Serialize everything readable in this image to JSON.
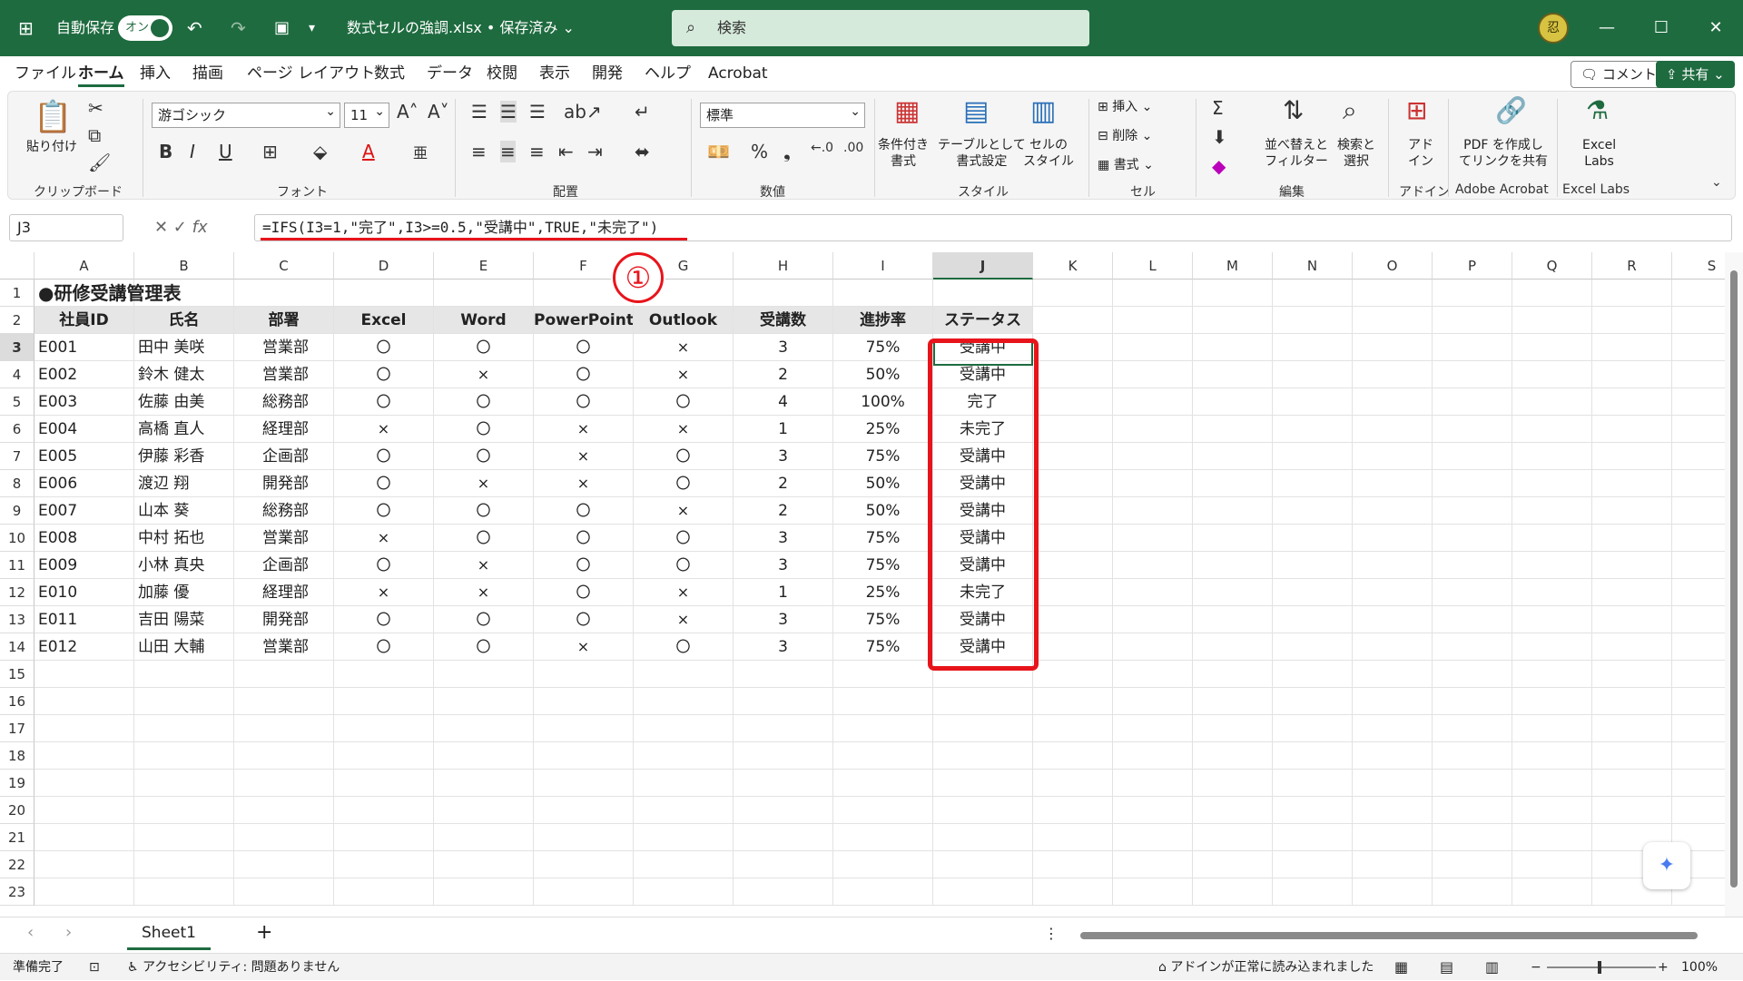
{
  "title_bar": {
    "autosave_label": "自動保存",
    "autosave_state": "オン",
    "filename": "数式セルの強調.xlsx • 保存済み ⌄",
    "search_placeholder": "検索",
    "avatar_text": "忍"
  },
  "menu": {
    "tabs": [
      "ファイル",
      "ホーム",
      "挿入",
      "描画",
      "ページ レイアウト",
      "数式",
      "データ",
      "校閲",
      "表示",
      "開発",
      "ヘルプ",
      "Acrobat"
    ],
    "active": "ホーム",
    "comment_button": "コメント",
    "share_button": "共有"
  },
  "ribbon": {
    "groups": [
      "クリップボード",
      "フォント",
      "配置",
      "数値",
      "スタイル",
      "セル",
      "編集",
      "アドイン",
      "Adobe Acrobat",
      "Excel Labs"
    ],
    "paste": "貼り付け",
    "font_name": "游ゴシック",
    "font_size": "11",
    "number_format": "標準",
    "conditional_format": "条件付き\n書式",
    "format_as_table": "テーブルとして\n書式設定",
    "cell_styles": "セルの\nスタイル",
    "insert": "挿入",
    "delete": "削除",
    "format": "書式",
    "sort_filter": "並べ替えと\nフィルター",
    "find_select": "検索と\n選択",
    "addin": "アド\nイン",
    "pdf_share": "PDF を作成し\nてリンクを共有",
    "excel_labs": "Excel\nLabs",
    "accent_color": "#1e6b3f"
  },
  "formula_bar": {
    "name_box": "J3",
    "formula": "=IFS(I3=1,\"完了\",I3>=0.5,\"受講中\",TRUE,\"未完了\")"
  },
  "annotation": {
    "number": "①",
    "highlight_color": "#e8141b"
  },
  "columns": [
    "A",
    "B",
    "C",
    "D",
    "E",
    "F",
    "G",
    "H",
    "I",
    "J",
    "K",
    "L",
    "M",
    "N",
    "O",
    "P",
    "Q",
    "R",
    "S"
  ],
  "rows": [
    "1",
    "2",
    "3",
    "4",
    "5",
    "6",
    "7",
    "8",
    "9",
    "10",
    "11",
    "12",
    "13",
    "14",
    "15",
    "16",
    "17",
    "18",
    "19",
    "20",
    "21",
    "22",
    "23"
  ],
  "sheet": {
    "title": "●研修受講管理表",
    "headers": [
      "社員ID",
      "氏名",
      "部署",
      "Excel",
      "Word",
      "PowerPoint",
      "Outlook",
      "受講数",
      "進捗率",
      "ステータス"
    ],
    "data": [
      [
        "E001",
        "田中 美咲",
        "営業部",
        "〇",
        "〇",
        "〇",
        "×",
        "3",
        "75%",
        "受講中"
      ],
      [
        "E002",
        "鈴木 健太",
        "営業部",
        "〇",
        "×",
        "〇",
        "×",
        "2",
        "50%",
        "受講中"
      ],
      [
        "E003",
        "佐藤 由美",
        "総務部",
        "〇",
        "〇",
        "〇",
        "〇",
        "4",
        "100%",
        "完了"
      ],
      [
        "E004",
        "高橋 直人",
        "経理部",
        "×",
        "〇",
        "×",
        "×",
        "1",
        "25%",
        "未完了"
      ],
      [
        "E005",
        "伊藤 彩香",
        "企画部",
        "〇",
        "〇",
        "×",
        "〇",
        "3",
        "75%",
        "受講中"
      ],
      [
        "E006",
        "渡辺 翔",
        "開発部",
        "〇",
        "×",
        "×",
        "〇",
        "2",
        "50%",
        "受講中"
      ],
      [
        "E007",
        "山本 葵",
        "総務部",
        "〇",
        "〇",
        "〇",
        "×",
        "2",
        "50%",
        "受講中"
      ],
      [
        "E008",
        "中村 拓也",
        "営業部",
        "×",
        "〇",
        "〇",
        "〇",
        "3",
        "75%",
        "受講中"
      ],
      [
        "E009",
        "小林 真央",
        "企画部",
        "〇",
        "×",
        "〇",
        "〇",
        "3",
        "75%",
        "受講中"
      ],
      [
        "E010",
        "加藤 優",
        "経理部",
        "×",
        "×",
        "〇",
        "×",
        "1",
        "25%",
        "未完了"
      ],
      [
        "E011",
        "吉田 陽菜",
        "開発部",
        "〇",
        "〇",
        "〇",
        "×",
        "3",
        "75%",
        "受講中"
      ],
      [
        "E012",
        "山田 大輔",
        "営業部",
        "〇",
        "〇",
        "×",
        "〇",
        "3",
        "75%",
        "受講中"
      ]
    ]
  },
  "sheet_tabs": {
    "active": "Sheet1",
    "add": "+"
  },
  "status_bar": {
    "ready": "準備完了",
    "accessibility": "アクセシビリティ: 問題ありません",
    "addin_msg": "アドインが正常に読み込まれました",
    "zoom": "100%"
  }
}
